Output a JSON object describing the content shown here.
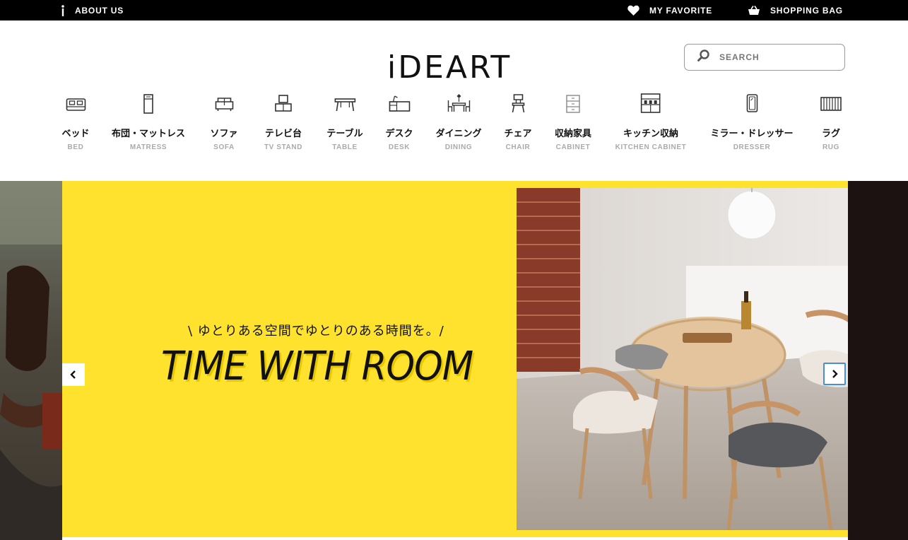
{
  "topbar": {
    "about_label": "ABOUT US",
    "favorite_label": "MY FAVORITE",
    "bag_label": "SHOPPING BAG"
  },
  "brand": {
    "logo_text": "iDEART"
  },
  "search": {
    "placeholder": "SEARCH"
  },
  "categories": [
    {
      "jp": "ベッド",
      "en": "BED",
      "icon": "bed-icon"
    },
    {
      "jp": "布団・マットレス",
      "en": "MATRESS",
      "icon": "mattress-icon"
    },
    {
      "jp": "ソファ",
      "en": "SOFA",
      "icon": "sofa-icon"
    },
    {
      "jp": "テレビ台",
      "en": "TV STAND",
      "icon": "tv-stand-icon"
    },
    {
      "jp": "テーブル",
      "en": "TABLE",
      "icon": "table-icon"
    },
    {
      "jp": "デスク",
      "en": "DESK",
      "icon": "desk-icon"
    },
    {
      "jp": "ダイニング",
      "en": "DINING",
      "icon": "dining-icon"
    },
    {
      "jp": "チェア",
      "en": "CHAIR",
      "icon": "chair-icon"
    },
    {
      "jp": "収納家具",
      "en": "CABINET",
      "icon": "cabinet-icon"
    },
    {
      "jp": "キッチン収納",
      "en": "KITCHEN CABINET",
      "icon": "kitchen-cabinet-icon"
    },
    {
      "jp": "ミラー・ドレッサー",
      "en": "DRESSER",
      "icon": "dresser-icon"
    },
    {
      "jp": "ラグ",
      "en": "RUG",
      "icon": "rug-icon"
    }
  ],
  "hero": {
    "tagline": "\\ ゆとりある空間でゆとりのある時間を。/",
    "headline": "TIME WITH ROOM",
    "accent_color": "#ffe22d"
  }
}
